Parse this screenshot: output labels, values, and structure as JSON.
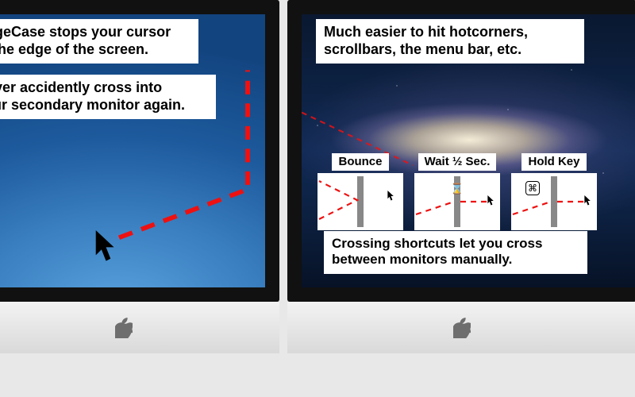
{
  "left": {
    "callout1": "EdgeCase stops your cursor\nat the edge of the screen.",
    "callout2": "Never accidently cross into\nyour secondary monitor again."
  },
  "right": {
    "callout1": "Much easier to hit hotcorners,\nscrollbars, the menu bar, etc.",
    "callout2": "Crossing shortcuts let you cross\nbetween monitors manually.",
    "cards": {
      "bounce": "Bounce",
      "wait": "Wait ½ Sec.",
      "hold": "Hold Key"
    }
  }
}
